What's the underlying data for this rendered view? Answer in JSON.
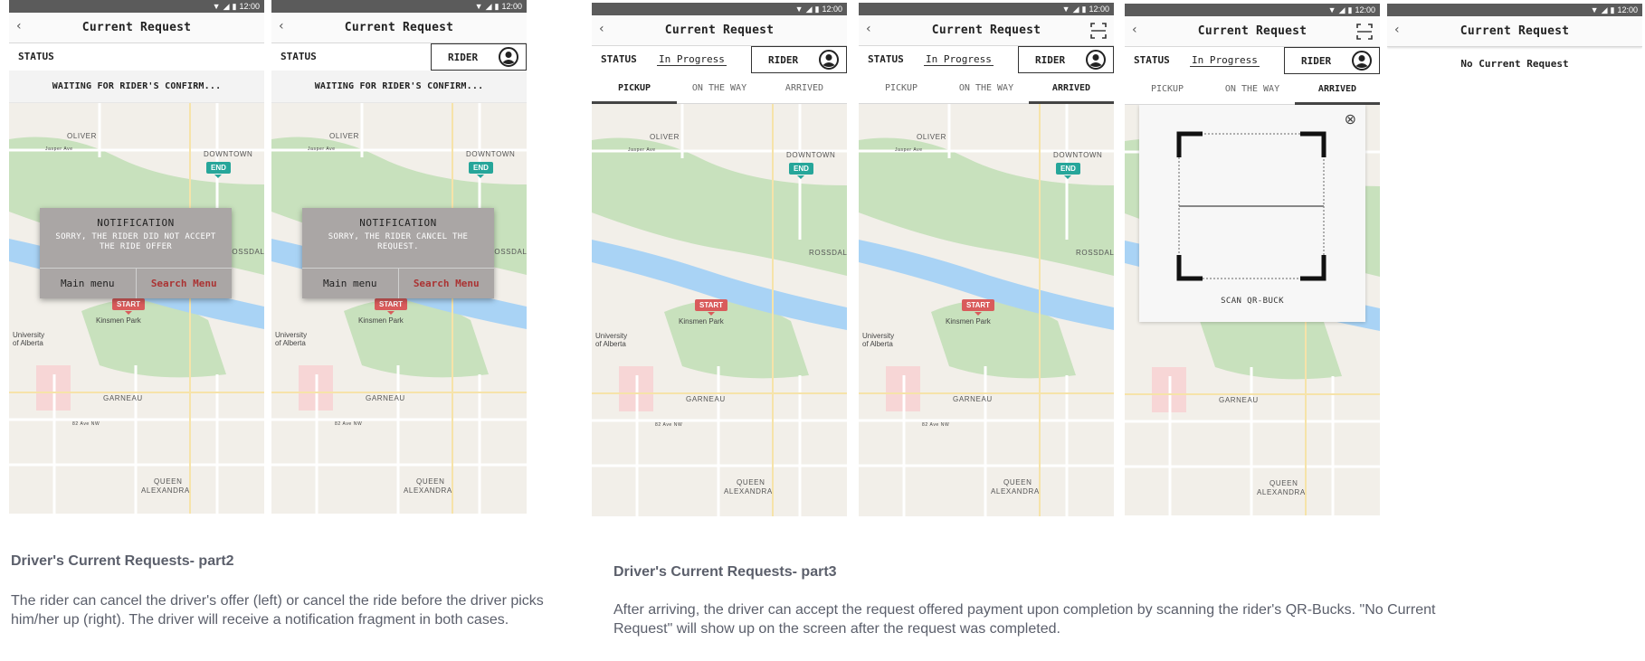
{
  "status_bar": {
    "time": "12:00"
  },
  "app": {
    "title": "Current Request",
    "back_glyph": "‹"
  },
  "status_row": {
    "label": "STATUS",
    "value": "In Progress",
    "rider_label": "RIDER"
  },
  "waiting_text": "WAITING FOR RIDER'S CONFIRM...",
  "tabs": [
    "PICKUP",
    "ON THE WAY",
    "ARRIVED"
  ],
  "map_labels": {
    "oliver": "OLIVER",
    "downtown": "DOWNTOWN",
    "rossdale": "ROSSDAL",
    "uofa": "University\nof Alberta",
    "kinsmen": "Kinsmen Park",
    "garneau": "GARNEAU",
    "queen": "QUEEN",
    "alexandra": "ALEXANDRA",
    "jasper": "Jasper Ave",
    "ave82": "82 Ave NW",
    "end_pin": "END",
    "start_pin": "START"
  },
  "notification_1": {
    "title": "NOTIFICATION",
    "message": "SORRY, THE RIDER DID NOT ACCEPT THE RIDE OFFER",
    "main_button": "Main menu",
    "search_button": "Search Menu"
  },
  "notification_2": {
    "title": "NOTIFICATION",
    "message": "SORRY, THE RIDER CANCEL THE REQUEST.",
    "main_button": "Main menu",
    "search_button": "Search Menu"
  },
  "scanner": {
    "label": "SCAN QR-BUCK"
  },
  "no_request_text": "No Current Request",
  "captions": {
    "part2_title": "Driver's Current Requests- part2",
    "part2_body": "The rider can cancel the driver's offer (left) or cancel the ride before the driver picks him/her up (right). The driver will receive a notification fragment in both cases.",
    "part3_title": "Driver's Current Requests- part3",
    "part3_body": "After arriving, the driver can accept the request offered payment upon completion by scanning the rider's QR-Bucks. \"No Current Request\" will show up on the screen after the request was completed."
  },
  "colors": {
    "end_pin": "#26a69a",
    "start_pin": "#d95b5b",
    "river": "#a9d3f5",
    "park": "#c8e1bd",
    "notification_bg": "#aaa6a5"
  }
}
